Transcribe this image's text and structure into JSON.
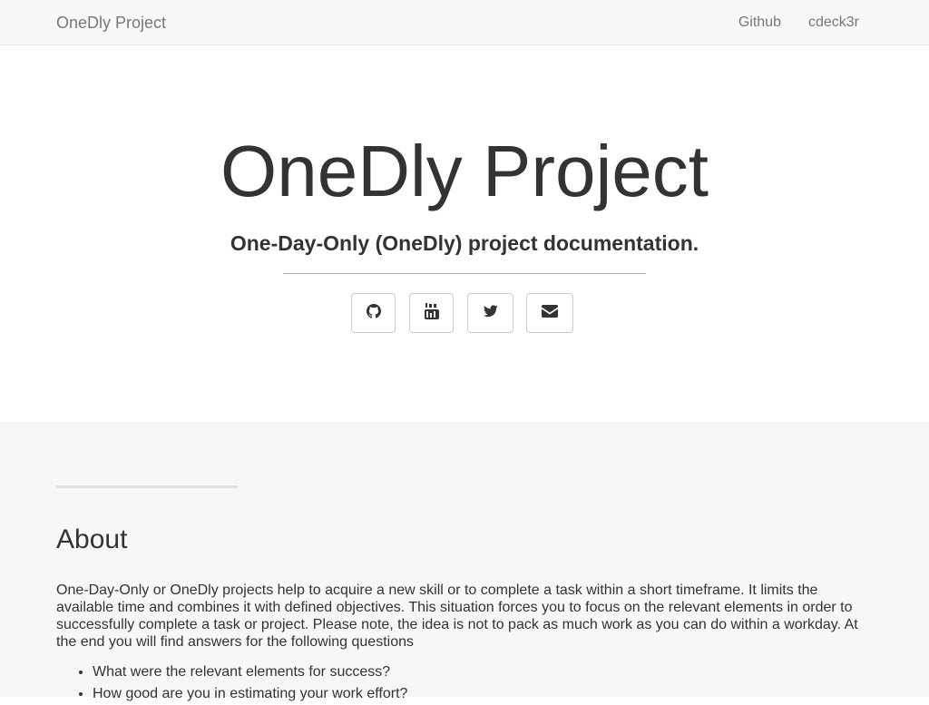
{
  "navbar": {
    "brand": "OneDly Project",
    "links": [
      "Github",
      "cdeck3r"
    ]
  },
  "hero": {
    "title": "OneDly Project",
    "subtitle": "One-Day-Only (OneDly) project documentation.",
    "social_buttons": [
      {
        "icon": "github-icon"
      },
      {
        "icon": "youtube-icon"
      },
      {
        "icon": "twitter-icon"
      },
      {
        "icon": "envelope-icon"
      }
    ]
  },
  "about": {
    "heading": "About",
    "paragraph": "One-Day-Only or OneDly projects help to acquire a new skill or to complete a task within a short timeframe. It limits the available time and combines it with defined objectives. This situation forces you to focus on the relevant elements in order to successfully complete a task or project. Please note, the idea is not to pack as much work as you can do within a workday. At the end you will find answers for the following questions",
    "questions": [
      "What were the relevant elements for success?",
      "How good are you in estimating your work effort?"
    ]
  },
  "colors": {
    "navbar_bg": "#f8f8f8",
    "section_bg": "#f7f7f7",
    "text": "#333333",
    "nav_text": "#777777"
  }
}
